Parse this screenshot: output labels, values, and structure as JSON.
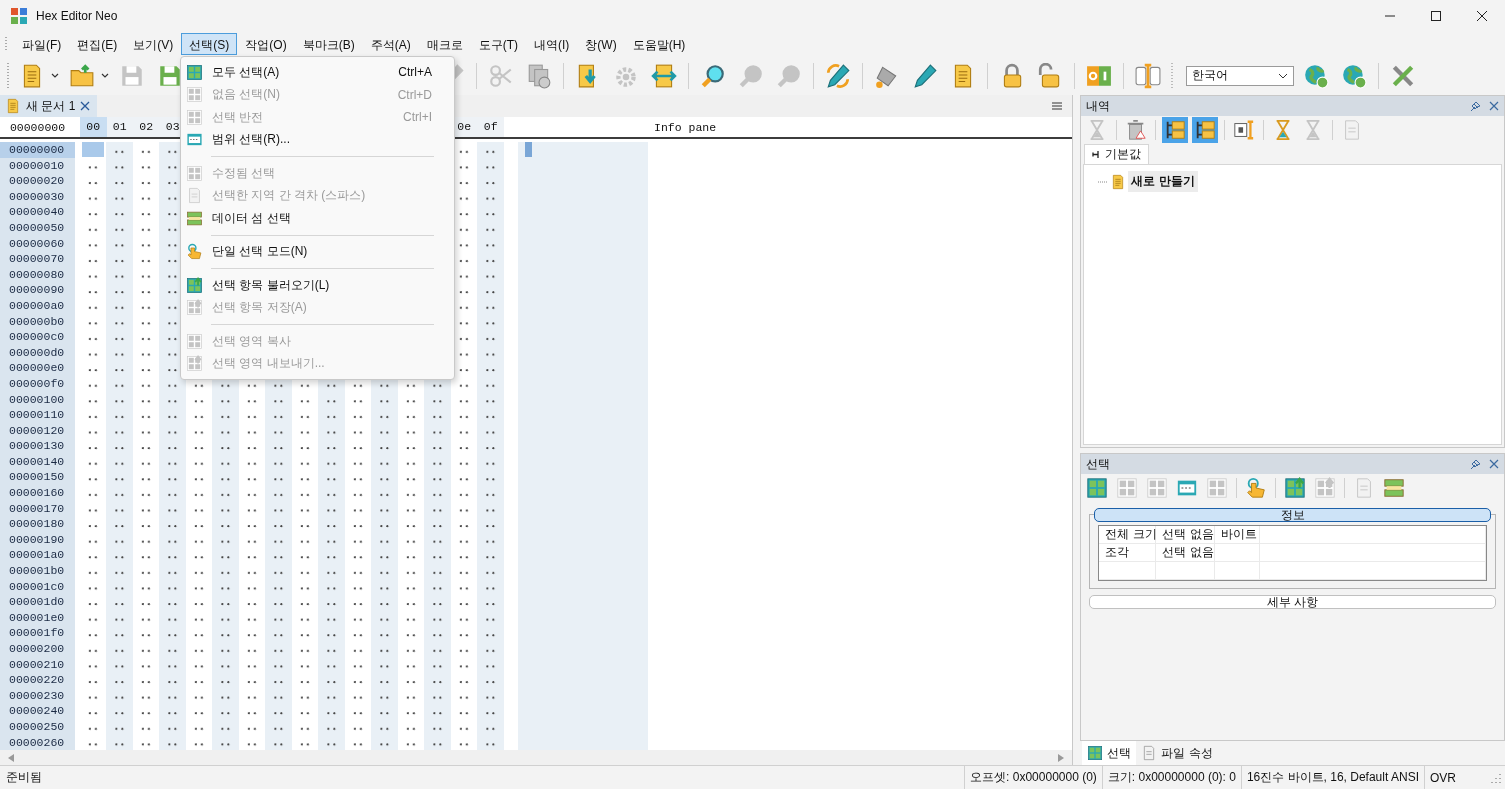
{
  "window": {
    "title": "Hex Editor Neo"
  },
  "menu": [
    {
      "label": "파일(F)",
      "selected": false
    },
    {
      "label": "편집(E)",
      "selected": false
    },
    {
      "label": "보기(V)",
      "selected": false
    },
    {
      "label": "선택(S)",
      "selected": true
    },
    {
      "label": "작업(O)",
      "selected": false
    },
    {
      "label": "북마크(B)",
      "selected": false
    },
    {
      "label": "주석(A)",
      "selected": false
    },
    {
      "label": "매크로",
      "selected": false
    },
    {
      "label": "도구(T)",
      "selected": false
    },
    {
      "label": "내역(I)",
      "selected": false
    },
    {
      "label": "창(W)",
      "selected": false
    },
    {
      "label": "도움말(H)",
      "selected": false
    }
  ],
  "toolbar": {
    "left": [
      {
        "kind": "button",
        "disabled": false
      },
      {
        "kind": "dropdown"
      },
      {
        "kind": "button",
        "disabled": false
      },
      {
        "kind": "dropdown"
      },
      {
        "kind": "button",
        "disabled": true
      },
      {
        "kind": "button",
        "disabled": false
      }
    ],
    "right": [
      {
        "kind": "button",
        "disabled": true
      },
      {
        "kind": "separator"
      },
      {
        "kind": "button",
        "disabled": true
      },
      {
        "kind": "button",
        "disabled": true
      },
      {
        "kind": "separator"
      },
      {
        "kind": "button",
        "disabled": false
      },
      {
        "kind": "button",
        "disabled": true
      },
      {
        "kind": "button",
        "disabled": false
      },
      {
        "kind": "separator"
      },
      {
        "kind": "button",
        "disabled": false
      },
      {
        "kind": "button",
        "disabled": true
      },
      {
        "kind": "button",
        "disabled": true
      },
      {
        "kind": "separator"
      },
      {
        "kind": "button",
        "disabled": false
      },
      {
        "kind": "separator"
      },
      {
        "kind": "button",
        "disabled": false
      },
      {
        "kind": "button",
        "disabled": false
      },
      {
        "kind": "button",
        "disabled": false
      },
      {
        "kind": "separator"
      },
      {
        "kind": "button",
        "disabled": false
      },
      {
        "kind": "button",
        "disabled": false
      },
      {
        "kind": "separator"
      },
      {
        "kind": "button",
        "disabled": false
      },
      {
        "kind": "separator"
      },
      {
        "kind": "button",
        "disabled": false
      },
      {
        "kind": "grip"
      },
      {
        "kind": "combo",
        "value": "한국어"
      },
      {
        "kind": "button",
        "disabled": false
      },
      {
        "kind": "button",
        "disabled": false
      },
      {
        "kind": "separator"
      },
      {
        "kind": "button",
        "disabled": false
      }
    ]
  },
  "document_tab": {
    "label": "새 문서 1",
    "selected": true
  },
  "editor": {
    "offset_header": "00000000",
    "columns_left": [
      {
        "label": "00",
        "selected": true
      },
      {
        "label": "01",
        "selected": false
      },
      {
        "label": "02",
        "selected": false
      },
      {
        "label": "03",
        "selected": false
      }
    ],
    "columns_right": [
      {
        "label": "0e",
        "selected": false
      },
      {
        "label": "0f",
        "selected": false
      }
    ],
    "info_pane_title": "Info pane",
    "offsets": [
      {
        "text": "00000000",
        "selected": true
      },
      {
        "text": "00000010",
        "selected": false
      },
      {
        "text": "00000020",
        "selected": false
      },
      {
        "text": "00000030",
        "selected": false
      },
      {
        "text": "00000040",
        "selected": false
      },
      {
        "text": "00000050",
        "selected": false
      },
      {
        "text": "00000060",
        "selected": false
      },
      {
        "text": "00000070",
        "selected": false
      },
      {
        "text": "00000080",
        "selected": false
      },
      {
        "text": "00000090",
        "selected": false
      },
      {
        "text": "000000a0",
        "selected": false
      },
      {
        "text": "000000b0",
        "selected": false
      },
      {
        "text": "000000c0",
        "selected": false
      },
      {
        "text": "000000d0",
        "selected": false
      },
      {
        "text": "000000e0",
        "selected": false
      },
      {
        "text": "000000f0",
        "selected": false
      },
      {
        "text": "00000100",
        "selected": false
      },
      {
        "text": "00000110",
        "selected": false
      },
      {
        "text": "00000120",
        "selected": false
      },
      {
        "text": "00000130",
        "selected": false
      },
      {
        "text": "00000140",
        "selected": false
      },
      {
        "text": "00000150",
        "selected": false
      },
      {
        "text": "00000160",
        "selected": false
      },
      {
        "text": "00000170",
        "selected": false
      },
      {
        "text": "00000180",
        "selected": false
      },
      {
        "text": "00000190",
        "selected": false
      },
      {
        "text": "000001a0",
        "selected": false
      },
      {
        "text": "000001b0",
        "selected": false
      },
      {
        "text": "000001c0",
        "selected": false
      },
      {
        "text": "000001d0",
        "selected": false
      },
      {
        "text": "000001e0",
        "selected": false
      },
      {
        "text": "000001f0",
        "selected": false
      },
      {
        "text": "00000200",
        "selected": false
      },
      {
        "text": "00000210",
        "selected": false
      },
      {
        "text": "00000220",
        "selected": false
      },
      {
        "text": "00000230",
        "selected": false
      },
      {
        "text": "00000240",
        "selected": false
      },
      {
        "text": "00000250",
        "selected": false
      },
      {
        "text": "00000260",
        "selected": false
      }
    ]
  },
  "select_menu": [
    {
      "kind": "item",
      "label": "모두 선택(A)",
      "shortcut": "Ctrl+A",
      "disabled": false
    },
    {
      "kind": "item",
      "label": "없음 선택(N)",
      "shortcut": "Ctrl+D",
      "disabled": true
    },
    {
      "kind": "item",
      "label": "선택 반전",
      "shortcut": "Ctrl+I",
      "disabled": true
    },
    {
      "kind": "item",
      "label": "범위 선택(R)...",
      "disabled": false
    },
    {
      "kind": "separator"
    },
    {
      "kind": "item",
      "label": "수정됨 선택",
      "disabled": true
    },
    {
      "kind": "item",
      "label": "선택한 지역 간 격차 (스파스)",
      "disabled": true
    },
    {
      "kind": "item",
      "label": "데이터 섬 선택",
      "disabled": false
    },
    {
      "kind": "separator"
    },
    {
      "kind": "item",
      "label": "단일 선택 모드(N)",
      "disabled": false
    },
    {
      "kind": "separator"
    },
    {
      "kind": "item",
      "label": "선택 항목 불러오기(L)",
      "disabled": false
    },
    {
      "kind": "item",
      "label": "선택 항목 저장(A)",
      "disabled": true
    },
    {
      "kind": "separator"
    },
    {
      "kind": "item",
      "label": "선택 영역 복사",
      "disabled": true
    },
    {
      "kind": "item",
      "label": "선택 영역 내보내기...",
      "disabled": true
    }
  ],
  "history_panel": {
    "title": "내역",
    "toolbar": [
      {
        "kind": "button",
        "disabled": true,
        "pressed": false
      },
      {
        "kind": "separator"
      },
      {
        "kind": "button",
        "disabled": true,
        "pressed": false
      },
      {
        "kind": "separator"
      },
      {
        "kind": "button",
        "disabled": false,
        "pressed": true
      },
      {
        "kind": "button",
        "disabled": false,
        "pressed": true
      },
      {
        "kind": "separator"
      },
      {
        "kind": "button",
        "disabled": false,
        "pressed": false
      },
      {
        "kind": "separator"
      },
      {
        "kind": "button",
        "disabled": false,
        "pressed": false
      },
      {
        "kind": "button",
        "disabled": true,
        "pressed": false
      },
      {
        "kind": "separator"
      },
      {
        "kind": "button",
        "disabled": true,
        "pressed": false
      }
    ],
    "tab": "기본값",
    "tree": [
      {
        "label": "새로 만들기",
        "selected": true
      }
    ]
  },
  "selection_panel": {
    "title": "선택",
    "toolbar": [
      {
        "kind": "button",
        "disabled": false
      },
      {
        "kind": "button",
        "disabled": true
      },
      {
        "kind": "button",
        "disabled": true
      },
      {
        "kind": "button",
        "disabled": false
      },
      {
        "kind": "button",
        "disabled": true
      },
      {
        "kind": "separator"
      },
      {
        "kind": "button",
        "disabled": false
      },
      {
        "kind": "separator"
      },
      {
        "kind": "button",
        "disabled": false
      },
      {
        "kind": "button",
        "disabled": true
      },
      {
        "kind": "separator"
      },
      {
        "kind": "button",
        "disabled": true
      },
      {
        "kind": "button",
        "disabled": false
      }
    ],
    "info_group": {
      "title": "정보",
      "expanded": true,
      "rows": [
        {
          "cells": [
            "전체 크기",
            "선택 없음",
            "바이트"
          ]
        },
        {
          "cells": [
            "조각",
            "선택 없음"
          ]
        }
      ]
    },
    "details_group": {
      "title": "세부 사항",
      "expanded": false
    }
  },
  "bottom_tabs": [
    {
      "label": "선택",
      "selected": true
    },
    {
      "label": "파일 속성",
      "selected": false
    }
  ],
  "status_bar": {
    "message": "준비됨",
    "fields": [
      "오프셋: 0x00000000 (0)",
      "크기: 0x00000000 (0): 0",
      "16진수 바이트, 16, Default ANSI",
      "OVR"
    ]
  }
}
